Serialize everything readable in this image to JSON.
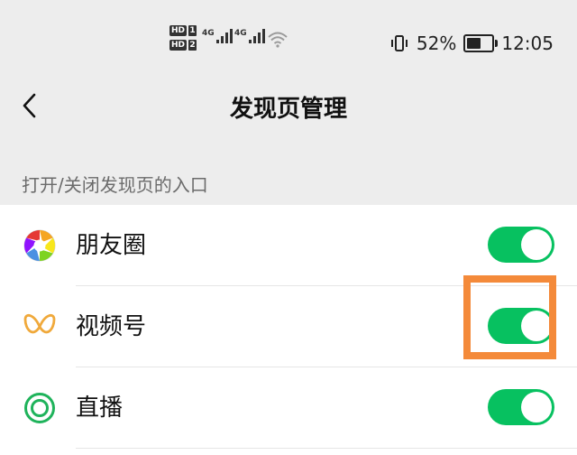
{
  "status_bar": {
    "battery_percent": "52%",
    "time": "12:05",
    "sim1": "HD",
    "sim1_num": "1",
    "sim2": "HD",
    "sim2_num": "2",
    "net1": "4G",
    "net2": "4G",
    "icons": [
      "hd-sim-icon",
      "signal-icon",
      "wifi-icon",
      "vibrate-icon",
      "battery-icon"
    ]
  },
  "navbar": {
    "title": "发现页管理",
    "back_icon": "chevron-left-icon"
  },
  "section": {
    "hint": "打开/关闭发现页的入口"
  },
  "items": [
    {
      "label": "朋友圈",
      "icon": "moments-aperture-icon",
      "enabled": true
    },
    {
      "label": "视频号",
      "icon": "channels-butterfly-icon",
      "enabled": true
    },
    {
      "label": "直播",
      "icon": "live-ring-icon",
      "enabled": true
    }
  ],
  "colors": {
    "toggle_on": "#07c160",
    "highlight": "#f48a3a",
    "background": "#ededed"
  }
}
